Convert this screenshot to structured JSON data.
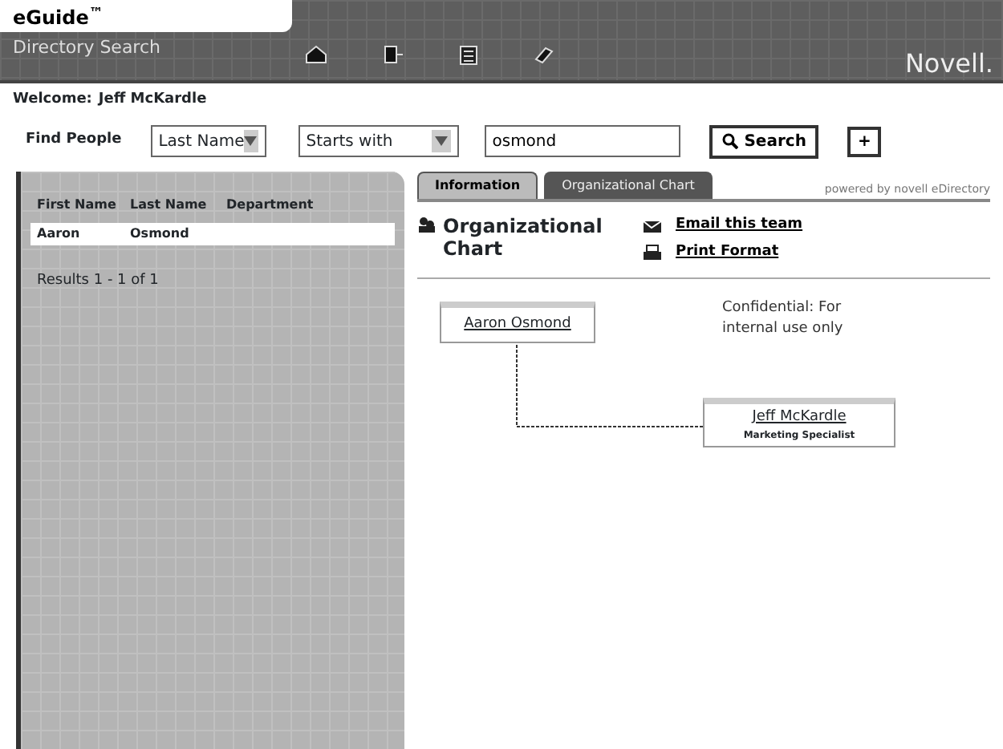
{
  "app": {
    "logo": "eGuide",
    "logo_mark": "™",
    "subtitle": "Directory Search",
    "brand": "Novell."
  },
  "welcome": {
    "label": "Welcome:",
    "user": "Jeff McKardle"
  },
  "search": {
    "label": "Find People",
    "field": "Last Name",
    "operator": "Starts with",
    "value": "osmond",
    "button": "Search",
    "add_button": "+"
  },
  "results": {
    "columns": [
      "First Name",
      "Last Name",
      "Department"
    ],
    "rows": [
      {
        "cells": [
          "Aaron",
          "Osmond"
        ],
        "selected": true
      }
    ],
    "summary": "Results 1 - 1 of 1"
  },
  "tabs": [
    {
      "label": "Information",
      "selected": false
    },
    {
      "label": "Organizational Chart",
      "selected": true
    }
  ],
  "powered": "powered by novell eDirectory",
  "section": {
    "title": "Organizational Chart",
    "links": [
      "Email this team",
      "Print Format"
    ]
  },
  "note": "Confidential: For internal use only",
  "org_nodes": [
    {
      "name": "Aaron Osmond"
    },
    {
      "name": "Jeff McKardle",
      "title": "Marketing Specialist"
    }
  ]
}
